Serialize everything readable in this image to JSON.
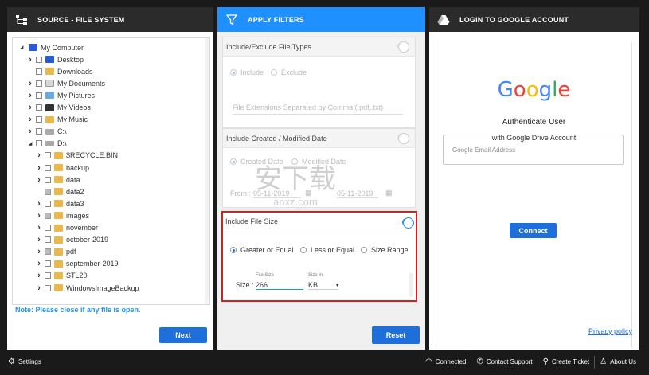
{
  "source_panel": {
    "title": "SOURCE - FILE SYSTEM",
    "tree": [
      {
        "label": "My Computer",
        "level": 0,
        "expanded": true,
        "icon": "computer-icon",
        "checkbox": false
      },
      {
        "label": "Desktop",
        "level": 1,
        "expanded": false,
        "icon": "desktop-icon",
        "checkbox": true,
        "checked": false
      },
      {
        "label": "Downloads",
        "level": 1,
        "expanded": null,
        "icon": "downloads-icon",
        "checkbox": true,
        "checked": false
      },
      {
        "label": "My Documents",
        "level": 1,
        "expanded": false,
        "icon": "documents-icon",
        "checkbox": true,
        "checked": false
      },
      {
        "label": "My Pictures",
        "level": 1,
        "expanded": false,
        "icon": "pictures-icon",
        "checkbox": true,
        "checked": false
      },
      {
        "label": "My Videos",
        "level": 1,
        "expanded": false,
        "icon": "videos-icon",
        "checkbox": true,
        "checked": false
      },
      {
        "label": "My Music",
        "level": 1,
        "expanded": false,
        "icon": "music-icon",
        "checkbox": true,
        "checked": false
      },
      {
        "label": "C:\\",
        "level": 1,
        "expanded": false,
        "icon": "drive-icon",
        "checkbox": true,
        "checked": false
      },
      {
        "label": "D:\\",
        "level": 1,
        "expanded": true,
        "icon": "drive-icon",
        "checkbox": true,
        "checked": false
      },
      {
        "label": "$RECYCLE.BIN",
        "level": 2,
        "expanded": false,
        "icon": "folder-icon",
        "checkbox": true,
        "checked": false
      },
      {
        "label": "backup",
        "level": 2,
        "expanded": false,
        "icon": "folder-icon",
        "checkbox": true,
        "checked": false
      },
      {
        "label": "data",
        "level": 2,
        "expanded": false,
        "icon": "folder-icon",
        "checkbox": true,
        "checked": false
      },
      {
        "label": "data2",
        "level": 2,
        "expanded": null,
        "icon": "folder-icon",
        "checkbox": true,
        "checked": true
      },
      {
        "label": "data3",
        "level": 2,
        "expanded": false,
        "icon": "folder-icon",
        "checkbox": true,
        "checked": false
      },
      {
        "label": "images",
        "level": 2,
        "expanded": false,
        "icon": "folder-icon",
        "checkbox": true,
        "checked": true
      },
      {
        "label": "november",
        "level": 2,
        "expanded": false,
        "icon": "folder-icon",
        "checkbox": true,
        "checked": false
      },
      {
        "label": "october-2019",
        "level": 2,
        "expanded": false,
        "icon": "folder-icon",
        "checkbox": true,
        "checked": false
      },
      {
        "label": "pdf",
        "level": 2,
        "expanded": false,
        "icon": "folder-icon",
        "checkbox": true,
        "checked": true
      },
      {
        "label": "september-2019",
        "level": 2,
        "expanded": false,
        "icon": "folder-icon",
        "checkbox": true,
        "checked": false
      },
      {
        "label": "STL20",
        "level": 2,
        "expanded": false,
        "icon": "folder-icon",
        "checkbox": true,
        "checked": false
      },
      {
        "label": "WindowsImageBackup",
        "level": 2,
        "expanded": false,
        "icon": "folder-icon",
        "checkbox": true,
        "checked": false
      }
    ],
    "note": "Note: Please close if any file is open.",
    "next_label": "Next"
  },
  "filter_panel": {
    "title": "APPLY FILTERS",
    "file_types": {
      "title": "Include/Exclude File Types",
      "include_label": "Include",
      "exclude_label": "Exclude",
      "extensions_placeholder": "File Extensions Separated by Comma (.pdf,.txt)"
    },
    "date": {
      "title": "Include Created / Modified Date",
      "created_label": "Created Date",
      "modified_label": "Modified Date",
      "from_label": "From :",
      "from_value": "05-11-2019",
      "to_value": "05-11-2019"
    },
    "file_size": {
      "title": "Include File Size",
      "greater_label": "Greater or Equal",
      "less_label": "Less or Equal",
      "range_label": "Size Range",
      "size_label": "Size :",
      "file_size_caption": "File Size",
      "size_in_caption": "Size in",
      "size_value": "266",
      "unit_value": "KB"
    },
    "reset_label": "Reset"
  },
  "google_panel": {
    "title": "LOGIN TO GOOGLE ACCOUNT",
    "logo_letters": [
      "G",
      "o",
      "o",
      "g",
      "l",
      "e"
    ],
    "logo_colors": [
      "#4285F4",
      "#EA4335",
      "#FBBC05",
      "#4285F4",
      "#34A853",
      "#EA4335"
    ],
    "heading": "Authenticate User",
    "subheading": "with Google Drive Account",
    "email_placeholder": "Google Email Address",
    "connect_label": "Connect",
    "privacy_label": "Privacy policy"
  },
  "statusbar": {
    "settings_label": "Settings",
    "connected_label": "Connected",
    "contact_label": "Contact Support",
    "ticket_label": "Create Ticket",
    "about_label": "About Us"
  },
  "watermark": {
    "text": "安下载",
    "subtext": "anxz.com"
  },
  "colors": {
    "accent": "#1e90ff",
    "button": "#1e6fd9",
    "highlight_border": "#d62020",
    "dark": "#2b2b2b"
  }
}
